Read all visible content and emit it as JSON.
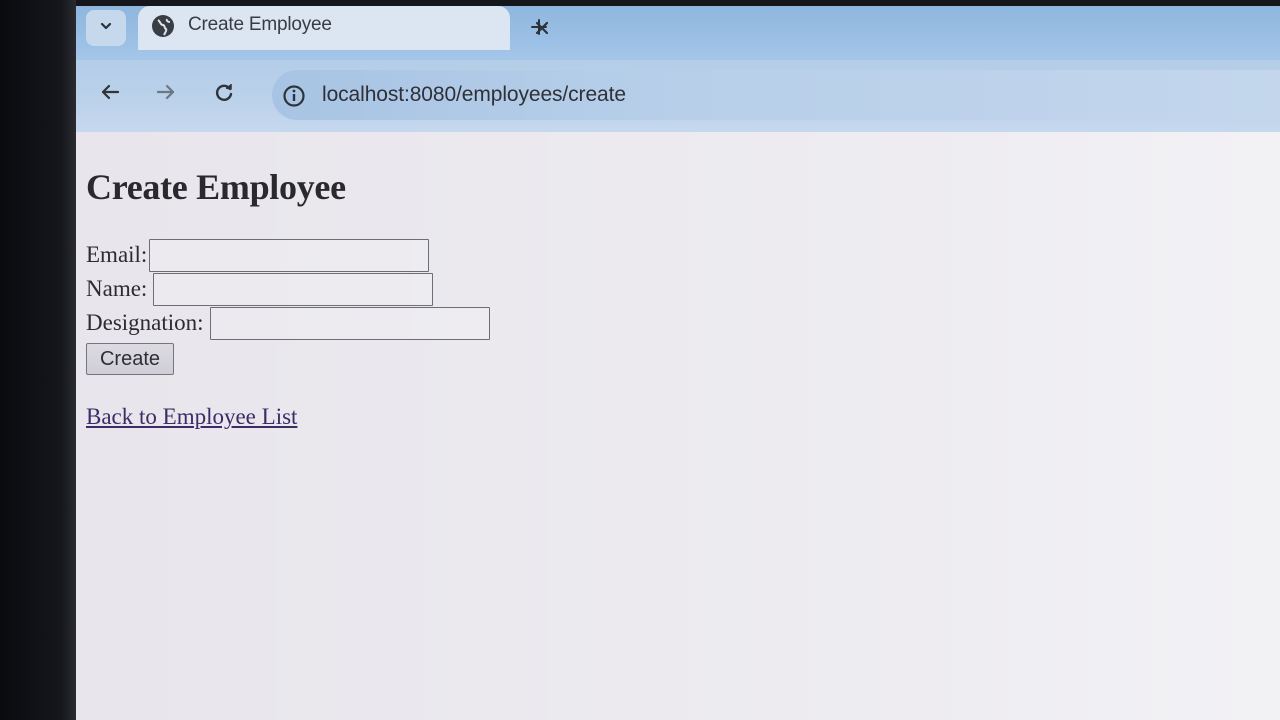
{
  "browser": {
    "tab": {
      "title": "Create Employee"
    },
    "address_bar": {
      "url": "localhost:8080/employees/create"
    }
  },
  "page": {
    "heading": "Create Employee",
    "form": {
      "email_label": "Email:",
      "email_value": "",
      "name_label": "Name:",
      "name_value": "",
      "designation_label": "Designation:",
      "designation_value": "",
      "submit_label": "Create"
    },
    "back_link": "Back to Employee List"
  },
  "icons": {
    "tab_menu": "chevron-down-icon",
    "favicon": "globe-icon",
    "tab_close": "close-icon",
    "new_tab": "plus-icon",
    "back": "arrow-left-icon",
    "forward": "arrow-right-icon",
    "reload": "reload-icon",
    "site_info": "info-icon"
  },
  "colors": {
    "tab_strip": "#9dc1e6",
    "toolbar": "#bad1ea",
    "page_background": "#e8e6ec",
    "link": "#3b2b66"
  }
}
